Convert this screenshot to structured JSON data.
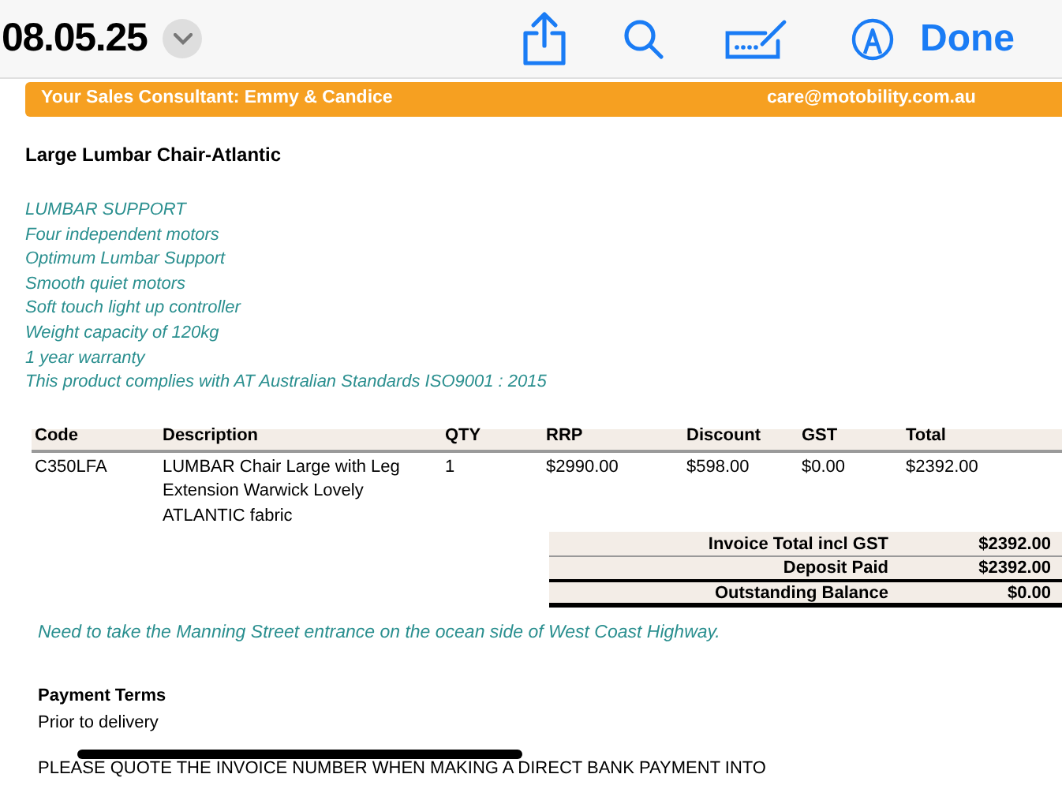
{
  "toolbar": {
    "title": "08.05.25",
    "done": "Done"
  },
  "banner": {
    "consultant": "Your Sales Consultant: Emmy & Candice",
    "email": "care@motobility.com.au"
  },
  "product_title": "Large Lumbar Chair-Atlantic",
  "features": [
    "LUMBAR SUPPORT",
    "Four independent motors",
    "Optimum Lumbar Support",
    "Smooth quiet motors",
    "Soft touch light up controller",
    "Weight capacity of 120kg",
    "1 year warranty",
    "This product complies with AT Australian Standards ISO9001 : 2015"
  ],
  "table": {
    "columns": [
      "Code",
      "Description",
      "QTY",
      "RRP",
      "Discount",
      "GST",
      "Total"
    ],
    "rows": [
      [
        "C350LFA",
        "LUMBAR Chair Large with Leg Extension Warwick Lovely ATLANTIC fabric",
        "1",
        "$2990.00",
        "$598.00",
        "$0.00",
        "$2392.00"
      ]
    ]
  },
  "totals": [
    {
      "label": "Invoice Total incl GST",
      "value": "$2392.00"
    },
    {
      "label": "Deposit Paid",
      "value": "$2392.00"
    },
    {
      "label": "Outstanding Balance",
      "value": "$0.00"
    }
  ],
  "note": "Need to take the Manning Street entrance on the ocean side of West Coast Highway.",
  "payment_terms": {
    "heading": "Payment Terms",
    "text": "Prior to delivery"
  },
  "bank_notice": "PLEASE QUOTE THE INVOICE NUMBER WHEN MAKING A DIRECT BANK PAYMENT INTO"
}
